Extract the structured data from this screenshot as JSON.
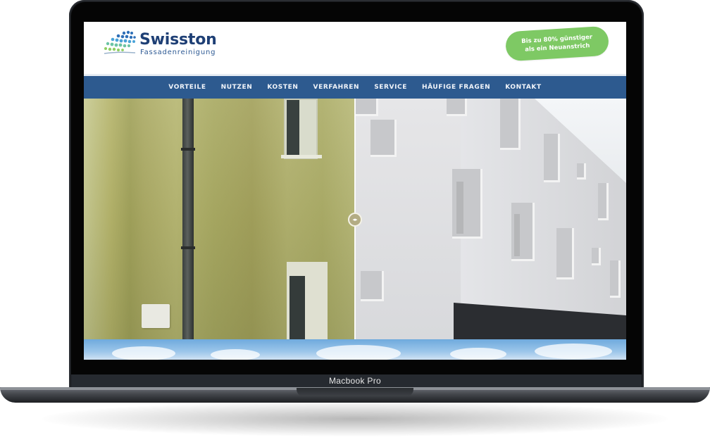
{
  "device": {
    "model_label": "Macbook Pro"
  },
  "header": {
    "brand_name": "Swisston",
    "brand_subtitle": "Fassadenreinigung",
    "badge_line1": "Bis zu 80% günstiger",
    "badge_line2": "als ein Neuanstrich",
    "badge_color": "#7ec964"
  },
  "nav": {
    "background": "#2d5a8f",
    "items": [
      {
        "label": "VORTEILE"
      },
      {
        "label": "NUTZEN"
      },
      {
        "label": "KOSTEN"
      },
      {
        "label": "VERFAHREN"
      },
      {
        "label": "SERVICE"
      },
      {
        "label": "HÄUFIGE FRAGEN"
      },
      {
        "label": "KONTAKT"
      }
    ]
  },
  "hero": {
    "type": "before-after-comparison-slider",
    "slider_handle_icon": "left-right-arrows-icon",
    "slider_position": 0.5
  },
  "colors": {
    "brand_blue": "#1e3f75",
    "accent_green": "#7ec964"
  }
}
